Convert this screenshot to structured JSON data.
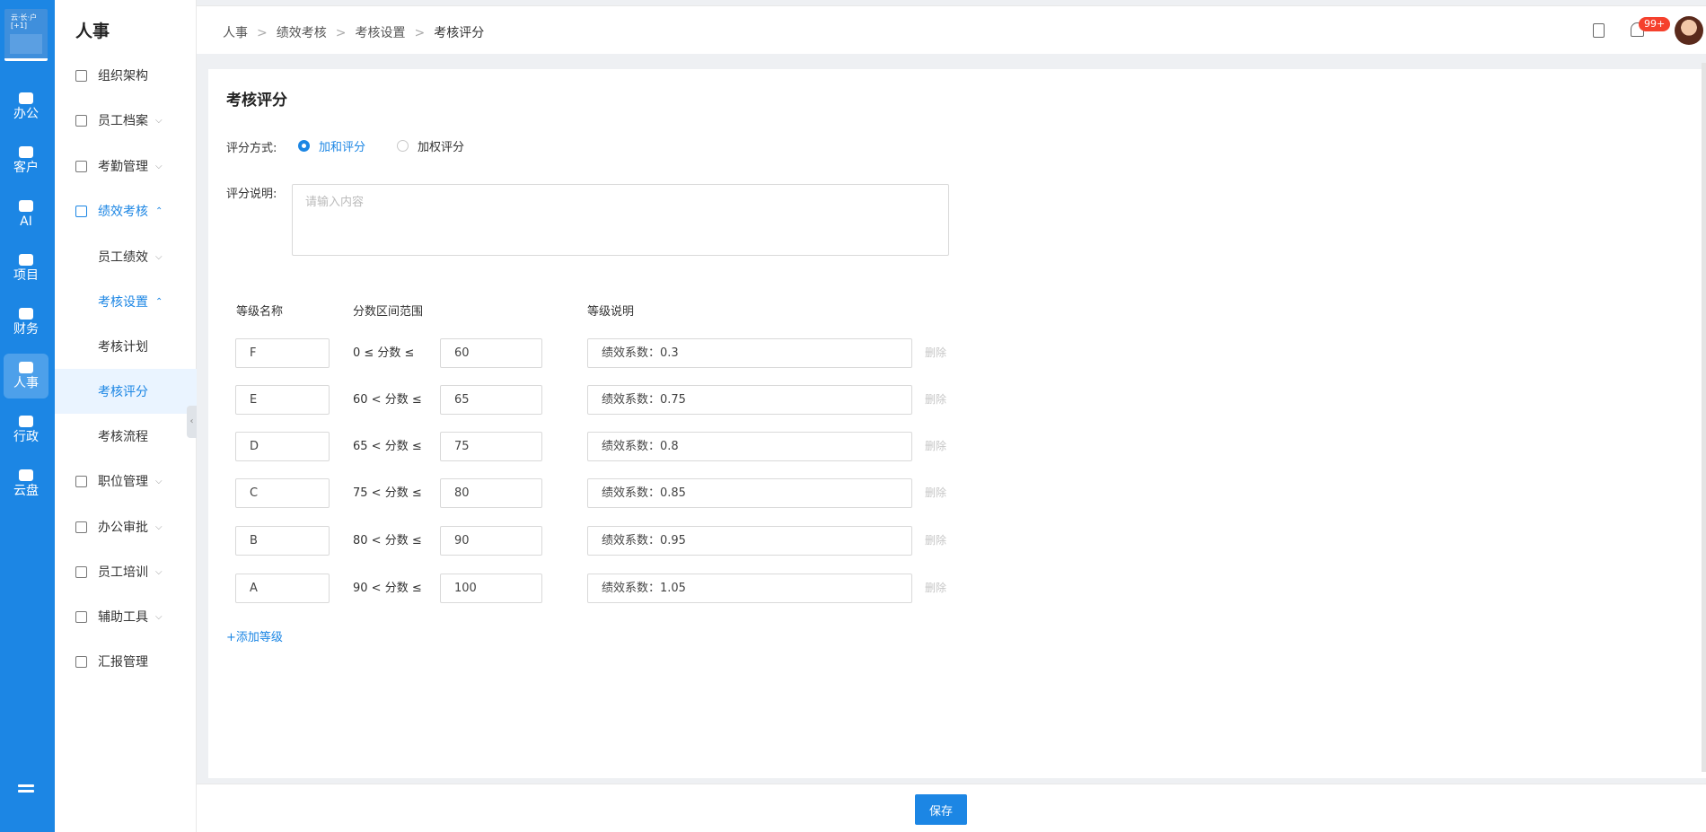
{
  "rail": {
    "logo_text": "云·长·户\n[+1]",
    "items": [
      {
        "label": "办公",
        "icon": "building-icon"
      },
      {
        "label": "客户",
        "icon": "user-icon"
      },
      {
        "label": "AI",
        "icon": "ai-icon"
      },
      {
        "label": "项目",
        "icon": "folder-icon"
      },
      {
        "label": "财务",
        "icon": "money-bag-icon"
      },
      {
        "label": "人事",
        "icon": "id-badge-icon"
      },
      {
        "label": "行政",
        "icon": "admin-card-icon"
      },
      {
        "label": "云盘",
        "icon": "cloud-drive-icon"
      }
    ],
    "active": "人事"
  },
  "nav": {
    "title": "人事",
    "items": [
      {
        "label": "组织架构",
        "icon": "org-chart-icon",
        "chevron": ""
      },
      {
        "label": "员工档案",
        "icon": "file-icon",
        "chevron": "⌵"
      },
      {
        "label": "考勤管理",
        "icon": "checkbox-icon",
        "chevron": "⌵"
      },
      {
        "label": "绩效考核",
        "icon": "chart-icon",
        "chevron": "⌃"
      },
      {
        "label": "员工绩效",
        "chevron": "⌵"
      },
      {
        "label": "考核设置",
        "chevron": "⌃"
      },
      {
        "label": "考核计划",
        "chevron": ""
      },
      {
        "label": "考核评分",
        "chevron": ""
      },
      {
        "label": "考核流程",
        "chevron": ""
      },
      {
        "label": "职位管理",
        "icon": "doc-icon",
        "chevron": "⌵"
      },
      {
        "label": "办公审批",
        "icon": "approve-icon",
        "chevron": "⌵"
      },
      {
        "label": "员工培训",
        "icon": "training-icon",
        "chevron": "⌵"
      },
      {
        "label": "辅助工具",
        "icon": "monitor-icon",
        "chevron": "⌵"
      },
      {
        "label": "汇报管理",
        "icon": "report-icon",
        "chevron": ""
      }
    ]
  },
  "breadcrumb": [
    "人事",
    "绩效考核",
    "考核设置",
    "考核评分"
  ],
  "header": {
    "badge": "99+"
  },
  "page": {
    "title": "考核评分",
    "scoring_method_label": "评分方式:",
    "methods": [
      "加和评分",
      "加权评分"
    ],
    "selected_method": "加和评分",
    "description_label": "评分说明:",
    "description_placeholder": "请输入内容",
    "columns": [
      "等级名称",
      "分数区间范围",
      "等级说明"
    ],
    "levels": [
      {
        "name": "F",
        "range": "0 ≤ 分数 ≤",
        "max": "60",
        "desc": "绩效系数：0.3"
      },
      {
        "name": "E",
        "range": "60 < 分数 ≤",
        "max": "65",
        "desc": "绩效系数：0.75"
      },
      {
        "name": "D",
        "range": "65 < 分数 ≤",
        "max": "75",
        "desc": "绩效系数：0.8"
      },
      {
        "name": "C",
        "range": "75 < 分数 ≤",
        "max": "80",
        "desc": "绩效系数：0.85"
      },
      {
        "name": "B",
        "range": "80 < 分数 ≤",
        "max": "90",
        "desc": "绩效系数：0.95"
      },
      {
        "name": "A",
        "range": "90 < 分数 ≤",
        "max": "100",
        "desc": "绩效系数：1.05"
      }
    ],
    "delete_label": "删除",
    "add_level_label": "+添加等级",
    "save_label": "保存"
  },
  "colors": {
    "primary": "#1c86e4",
    "badge": "#f5412d"
  }
}
